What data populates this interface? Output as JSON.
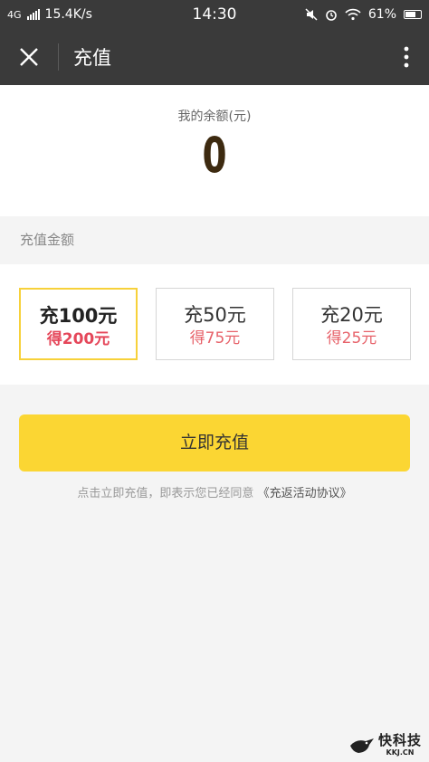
{
  "status_bar": {
    "network": "4G",
    "speed": "15.4K/s",
    "time": "14:30",
    "battery": "61%",
    "icons": [
      "signal-icon",
      "mute-icon",
      "alarm-icon",
      "wifi-icon",
      "battery-icon"
    ]
  },
  "nav": {
    "title": "充值",
    "close_icon": "close-icon",
    "more_icon": "more-vertical-icon"
  },
  "balance": {
    "label": "我的余额(元)",
    "value": "0"
  },
  "section": {
    "label": "充值金额"
  },
  "options": [
    {
      "main": "充100元",
      "sub": "得200元",
      "selected": true
    },
    {
      "main": "充50元",
      "sub": "得75元",
      "selected": false
    },
    {
      "main": "充20元",
      "sub": "得25元",
      "selected": false
    }
  ],
  "actions": {
    "pay_label": "立即充值",
    "agreement_text": "点击立即充值，即表示您已经同意",
    "agreement_link": "《充返活动协议》"
  },
  "watermark": {
    "main": "快科技",
    "sub": "KKJ.CN"
  },
  "colors": {
    "bar_bg": "#3a3a3a",
    "accent_yellow": "#fbd633",
    "selected_border": "#f7d13a",
    "bonus_red": "#e5475a",
    "balance_brown": "#3d2a10"
  }
}
